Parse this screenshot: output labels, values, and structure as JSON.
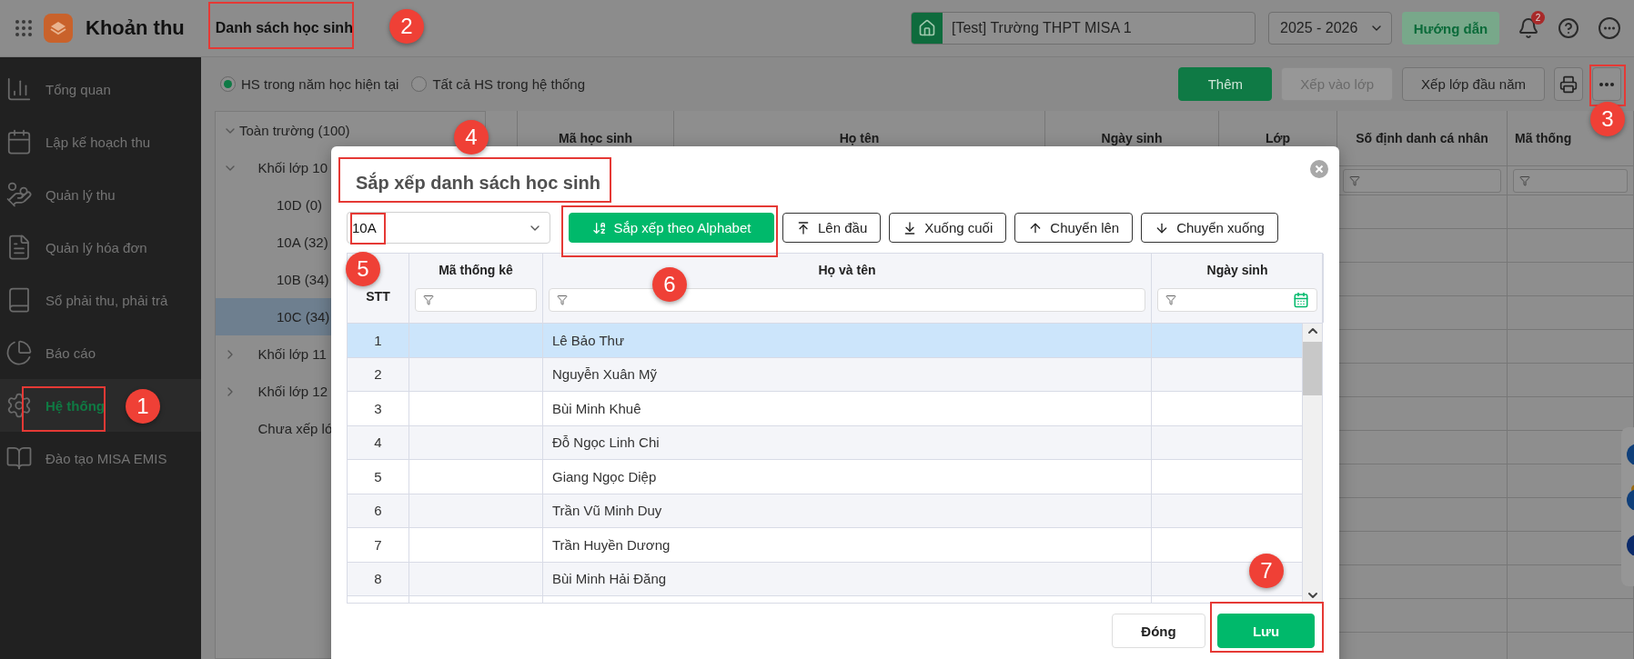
{
  "app": {
    "name": "Khoản thu"
  },
  "page_title": "Danh sách học sinh",
  "school": "[Test] Trường THPT MISA 1",
  "school_year": "2025 - 2026",
  "guide_button": "Hướng dẫn",
  "notification_count": "2",
  "sidebar": {
    "items": [
      {
        "label": "Tổng quan",
        "selected": false
      },
      {
        "label": "Lập kế hoạch thu",
        "selected": false
      },
      {
        "label": "Quản lý thu",
        "selected": false
      },
      {
        "label": "Quản lý hóa đơn",
        "selected": false
      },
      {
        "label": "Sổ phải thu, phải trả",
        "selected": false
      },
      {
        "label": "Báo cáo",
        "selected": false
      },
      {
        "label": "Hệ thống",
        "selected": true
      },
      {
        "label": "Đào tạo MISA EMIS",
        "selected": false
      }
    ]
  },
  "scope_filter": [
    {
      "label": "HS trong năm học hiện tại",
      "selected": true
    },
    {
      "label": "Tất cả HS trong hệ thống",
      "selected": false
    }
  ],
  "actions": [
    {
      "label": "Thêm",
      "kind": "primary",
      "disabled": false
    },
    {
      "label": "Xếp vào lớp",
      "kind": "secondary",
      "disabled": true
    },
    {
      "label": "Xếp lớp đầu năm",
      "kind": "secondary",
      "disabled": false
    }
  ],
  "class_tree": [
    {
      "label": "Toàn trường (100)",
      "expanded": true,
      "selected": false,
      "children": [
        {
          "label": "Khối lớp 10",
          "expanded": true,
          "selected": false,
          "children": [
            {
              "label": "10D (0)",
              "selected": false
            },
            {
              "label": "10A (32)",
              "selected": false
            },
            {
              "label": "10B (34)",
              "selected": false
            },
            {
              "label": "10C (34)",
              "selected": true
            }
          ]
        },
        {
          "label": "Khối lớp 11",
          "expanded": false,
          "selected": false
        },
        {
          "label": "Khối lớp 12",
          "expanded": false,
          "selected": false
        },
        {
          "label": "Chưa xếp lớ",
          "selected": false
        }
      ]
    }
  ],
  "student_grid": {
    "columns": [
      "Mã học sinh",
      "Họ tên",
      "Ngày sinh",
      "Lớp",
      "Số định danh cá nhân",
      "Mã thống"
    ]
  },
  "dialog": {
    "title": "Sắp xếp danh sách học sinh",
    "class_select": "10A",
    "sort_buttons": [
      {
        "label": "Sắp xếp theo Alphabet",
        "kind": "primary"
      },
      {
        "label": "Lên đầu",
        "kind": "secondary"
      },
      {
        "label": "Xuống cuối",
        "kind": "secondary"
      },
      {
        "label": "Chuyển lên",
        "kind": "secondary"
      },
      {
        "label": "Chuyển xuống",
        "kind": "secondary"
      }
    ],
    "columns": [
      {
        "label": "STT",
        "kind": "plain"
      },
      {
        "label": "Mã thống kê",
        "kind": "text-filter"
      },
      {
        "label": "Họ và tên",
        "kind": "text-filter"
      },
      {
        "label": "Ngày sinh",
        "kind": "date-filter"
      }
    ],
    "rows": [
      {
        "stt": "1",
        "name": "Lê Bảo Thư",
        "selected": true
      },
      {
        "stt": "2",
        "name": "Nguyễn Xuân Mỹ",
        "selected": false
      },
      {
        "stt": "3",
        "name": "Bùi Minh Khuê",
        "selected": false
      },
      {
        "stt": "4",
        "name": "Đỗ Ngọc Linh Chi",
        "selected": false
      },
      {
        "stt": "5",
        "name": "Giang Ngọc Diệp",
        "selected": false
      },
      {
        "stt": "6",
        "name": "Trần Vũ Minh Duy",
        "selected": false
      },
      {
        "stt": "7",
        "name": "Trần Huyền Dương",
        "selected": false
      },
      {
        "stt": "8",
        "name": "Bùi Minh Hải Đăng",
        "selected": false
      }
    ],
    "buttons": [
      {
        "label": "Đóng",
        "kind": "secondary"
      },
      {
        "label": "Lưu",
        "kind": "primary"
      }
    ]
  },
  "annotations": [
    "1",
    "2",
    "3",
    "4",
    "5",
    "6",
    "7"
  ]
}
